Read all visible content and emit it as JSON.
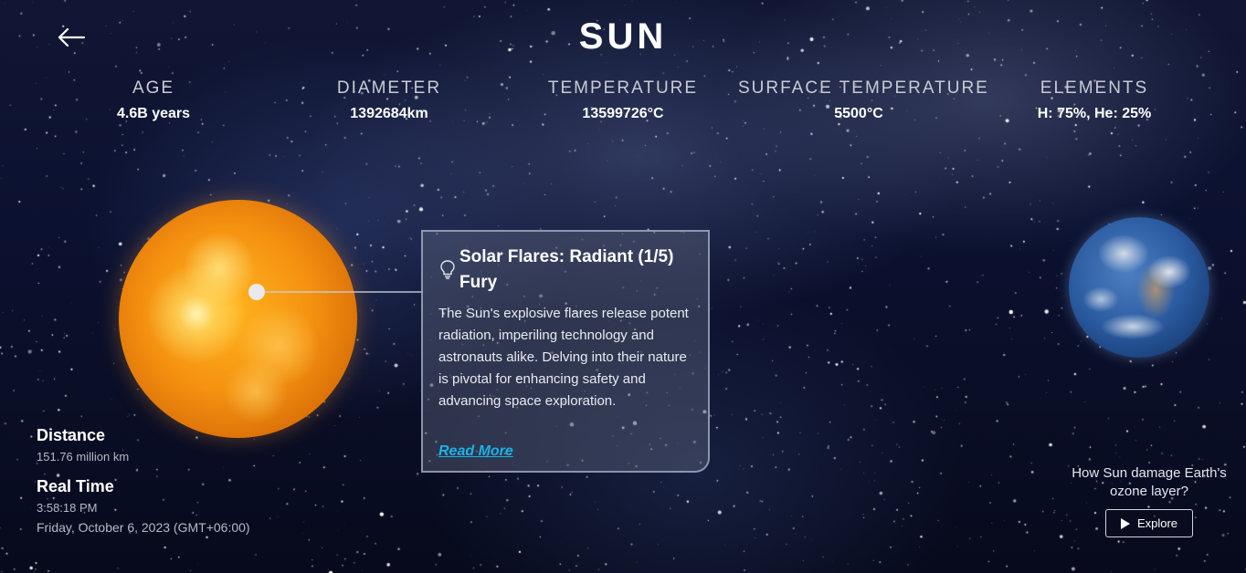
{
  "page": {
    "title": "SUN"
  },
  "stats": [
    {
      "label": "AGE",
      "value": "4.6B years"
    },
    {
      "label": "DIAMETER",
      "value": "1392684km"
    },
    {
      "label": "TEMPERATURE",
      "value": "13599726°C"
    },
    {
      "label": "SURFACE TEMPERATURE",
      "value": "5500°C"
    },
    {
      "label": "ELEMENTS",
      "value": "H: 75%, He: 25%"
    }
  ],
  "info_card": {
    "title": "Solar Flares: Radiant (1/5) Fury",
    "body": "The Sun's explosive flares release potent radiation, imperiling technology and astronauts alike. Delving into their nature is pivotal for enhancing safety and advancing space exploration.",
    "link_label": "Read More"
  },
  "distance": {
    "label": "Distance",
    "value": "151.76 million km"
  },
  "real_time": {
    "label": "Real Time",
    "time": "3:58:18 PM",
    "date": "Friday, October 6, 2023 (GMT+06:00)"
  },
  "explore": {
    "question": "How Sun damage Earth's ozone layer?",
    "button_label": "Explore"
  },
  "icons": {
    "back": "back-arrow-icon",
    "card": "lightbulb-icon",
    "play": "play-icon"
  },
  "colors": {
    "link": "#19b4e6",
    "sun": "#f59210",
    "background": "#0b1130"
  }
}
